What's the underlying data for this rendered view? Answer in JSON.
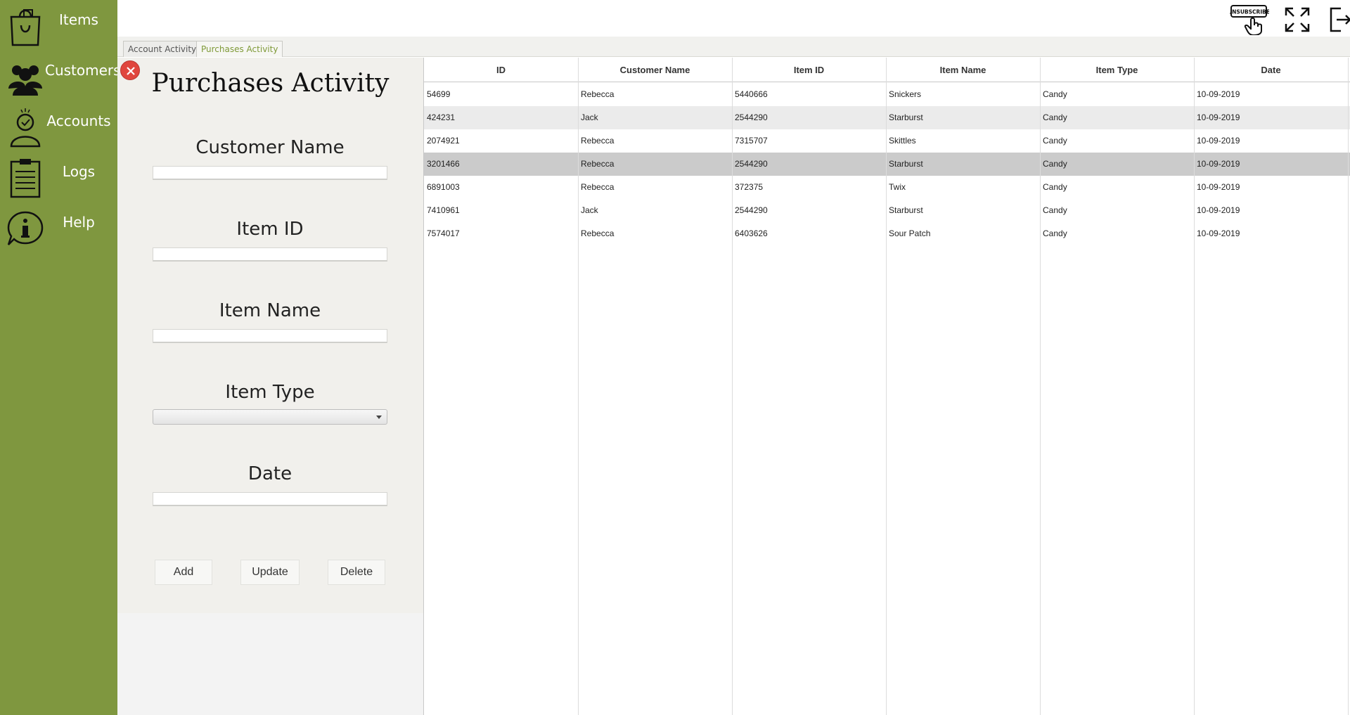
{
  "sidebar": {
    "items": [
      {
        "label": "Items",
        "icon": "shopping-bag-icon"
      },
      {
        "label": "Customers",
        "icon": "people-icon"
      },
      {
        "label": "Accounts",
        "icon": "user-account-icon"
      },
      {
        "label": "Logs",
        "icon": "clipboard-icon"
      },
      {
        "label": "Help",
        "icon": "info-bubble-icon"
      }
    ]
  },
  "topbar": {
    "unsubscribe_text": "UNSUBSCRIBE"
  },
  "tabs": [
    {
      "label": "Account Activity",
      "active": false
    },
    {
      "label": "Purchases Activity",
      "active": true
    }
  ],
  "form": {
    "title": "Purchases Activity",
    "fields": {
      "customer_name": {
        "label": "Customer Name",
        "value": ""
      },
      "item_id": {
        "label": "Item ID",
        "value": ""
      },
      "item_name": {
        "label": "Item Name",
        "value": ""
      },
      "item_type": {
        "label": "Item Type",
        "value": ""
      },
      "date": {
        "label": "Date",
        "value": ""
      }
    },
    "buttons": {
      "add": "Add",
      "update": "Update",
      "delete": "Delete"
    }
  },
  "table": {
    "columns": [
      "ID",
      "Customer Name",
      "Item ID",
      "Item Name",
      "Item Type",
      "Date"
    ],
    "rows": [
      [
        "54699",
        "Rebecca",
        "5440666",
        "Snickers",
        "Candy",
        "10-09-2019"
      ],
      [
        "424231",
        "Jack",
        "2544290",
        "Starburst",
        "Candy",
        "10-09-2019"
      ],
      [
        "2074921",
        "Rebecca",
        "7315707",
        "Skittles",
        "Candy",
        "10-09-2019"
      ],
      [
        "3201466",
        "Rebecca",
        "2544290",
        "Starburst",
        "Candy",
        "10-09-2019"
      ],
      [
        "6891003",
        "Rebecca",
        "372375",
        "Twix",
        "Candy",
        "10-09-2019"
      ],
      [
        "7410961",
        "Jack",
        "2544290",
        "Starburst",
        "Candy",
        "10-09-2019"
      ],
      [
        "7574017",
        "Rebecca",
        "6403626",
        "Sour Patch",
        "Candy",
        "10-09-2019"
      ]
    ],
    "selected_row": 3
  },
  "colors": {
    "sidebar": "#7f973f",
    "active_tab_text": "#7f9a38",
    "close_button": "#e0463e",
    "selected_row": "#cbcbcb"
  }
}
